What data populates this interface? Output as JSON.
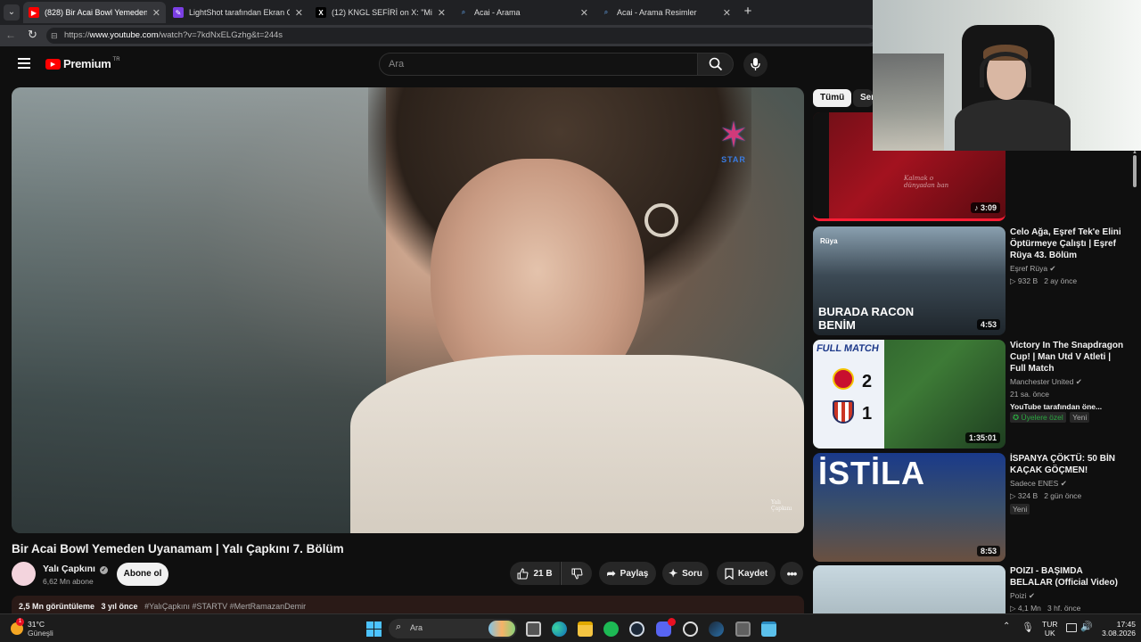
{
  "browser": {
    "tabs": [
      {
        "title": "(828) Bir Acai Bowl Yemeden Uyan",
        "active": true
      },
      {
        "title": "LightShot tarafından Ekran Görünt"
      },
      {
        "title": "(12) KNGL SEFİRİ on X: \"Minik sike"
      },
      {
        "title": "Acai - Arama"
      },
      {
        "title": "Acai - Arama Resimler"
      }
    ],
    "url_prefix": "https://",
    "url_host": "www.youtube.com",
    "url_path": "/watch?v=7kdNxELGzhg&t=244s"
  },
  "header": {
    "logo_text": "Premium",
    "logo_region": "TR",
    "search_placeholder": "Ara"
  },
  "video": {
    "watermark": "STAR",
    "corner_mark": "Yalı Çapkını",
    "title": "Bir Acai Bowl Yemeden Uyanamam | Yalı Çapkını 7. Bölüm",
    "channel_name": "Yalı Çapkını",
    "subscribers": "6,62 Mn abone",
    "subscribe_label": "Abone ol",
    "likes": "21 B",
    "share_label": "Paylaş",
    "ask_label": "Soru",
    "save_label": "Kaydet",
    "views": "2,5 Mn görüntüleme",
    "age": "3 yıl önce",
    "hashtags": "#YalıÇapkını #STARTV #MertRamazanDemir"
  },
  "chips": [
    {
      "label": "Tümü",
      "active": true
    },
    {
      "label": "Ser"
    }
  ],
  "sidebar": [
    {
      "duration": "3:09",
      "thumb_text": "Kalmak o dünyadan ban"
    },
    {
      "title": "Celo Ağa, Eşref Tek'e Elini Öptürmeye Çalıştı | Eşref Rüya 43. Bölüm",
      "channel": "Eşref Rüya",
      "meta": "932 B   2 ay önce",
      "duration": "4:53",
      "thumb_text": "BURADA RACON BENİM",
      "thumb_tag": "Rüya"
    },
    {
      "title": "Victory In The Snapdragon Cup! | Man Utd V Atleti | Full Match",
      "channel": "Manchester United",
      "meta": "21 sa. önce",
      "extra": "YouTube tarafından öne...",
      "badge1": "Üyelere özel",
      "badge2": "Yeni",
      "duration": "1:35:01",
      "thumb_text": "FULL MATCH",
      "score_top": "2",
      "score_bottom": "1"
    },
    {
      "title": "İSPANYA ÇÖKTÜ: 50 BİN KAÇAK GÖÇMEN!",
      "channel": "Sadece ENES",
      "meta": "324 B   2 gün önce",
      "badge2": "Yeni",
      "duration": "8:53",
      "thumb_text": "İSTİLA"
    },
    {
      "title": "POIZI - BAŞIMDA BELALAR (Official Video)",
      "channel": "Poizi",
      "meta": "4,1 Mn   3 hf. önce"
    }
  ],
  "taskbar": {
    "weather_temp": "31°C",
    "weather_desc": "Güneşli",
    "search_label": "Ara",
    "lang1": "TUR",
    "lang2": "UK",
    "time": "17:45",
    "date": "3.08.2026",
    "notif_count": "1"
  }
}
